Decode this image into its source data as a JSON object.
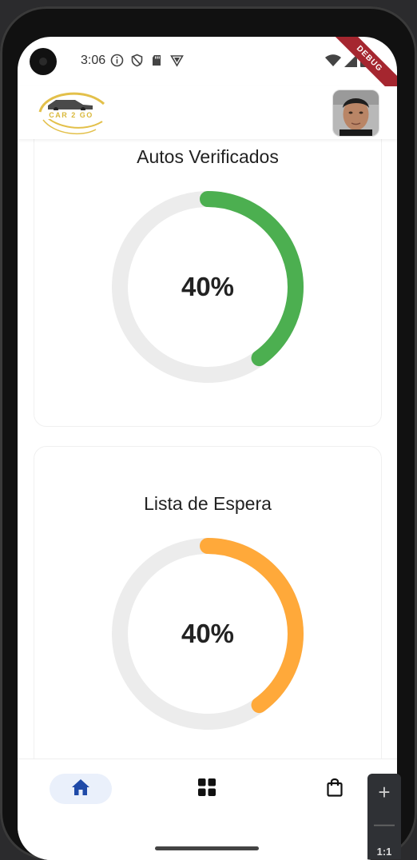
{
  "status_bar": {
    "time": "3:06"
  },
  "debug_banner": "DEBUG",
  "header": {
    "logo_text": "CAR 2 GO"
  },
  "cards": [
    {
      "title": "Autos Verificados",
      "percent_text": "40%",
      "progress": 0.4,
      "color": "#4caf50"
    },
    {
      "title": "Lista de Espera",
      "percent_text": "40%",
      "progress": 0.4,
      "color": "#ffa93a"
    }
  ],
  "colors": {
    "track": "#ececec",
    "nav_active_bg": "#eaf0fb",
    "nav_active_icon": "#1f4aa8"
  },
  "bottom_nav": {
    "items": [
      {
        "icon": "home-icon",
        "active": true
      },
      {
        "icon": "grid-icon",
        "active": false
      },
      {
        "icon": "shopping-bag-icon",
        "active": false
      }
    ]
  },
  "zoom_control": {
    "plus": "+",
    "minus": "—",
    "reset": "1:1"
  }
}
